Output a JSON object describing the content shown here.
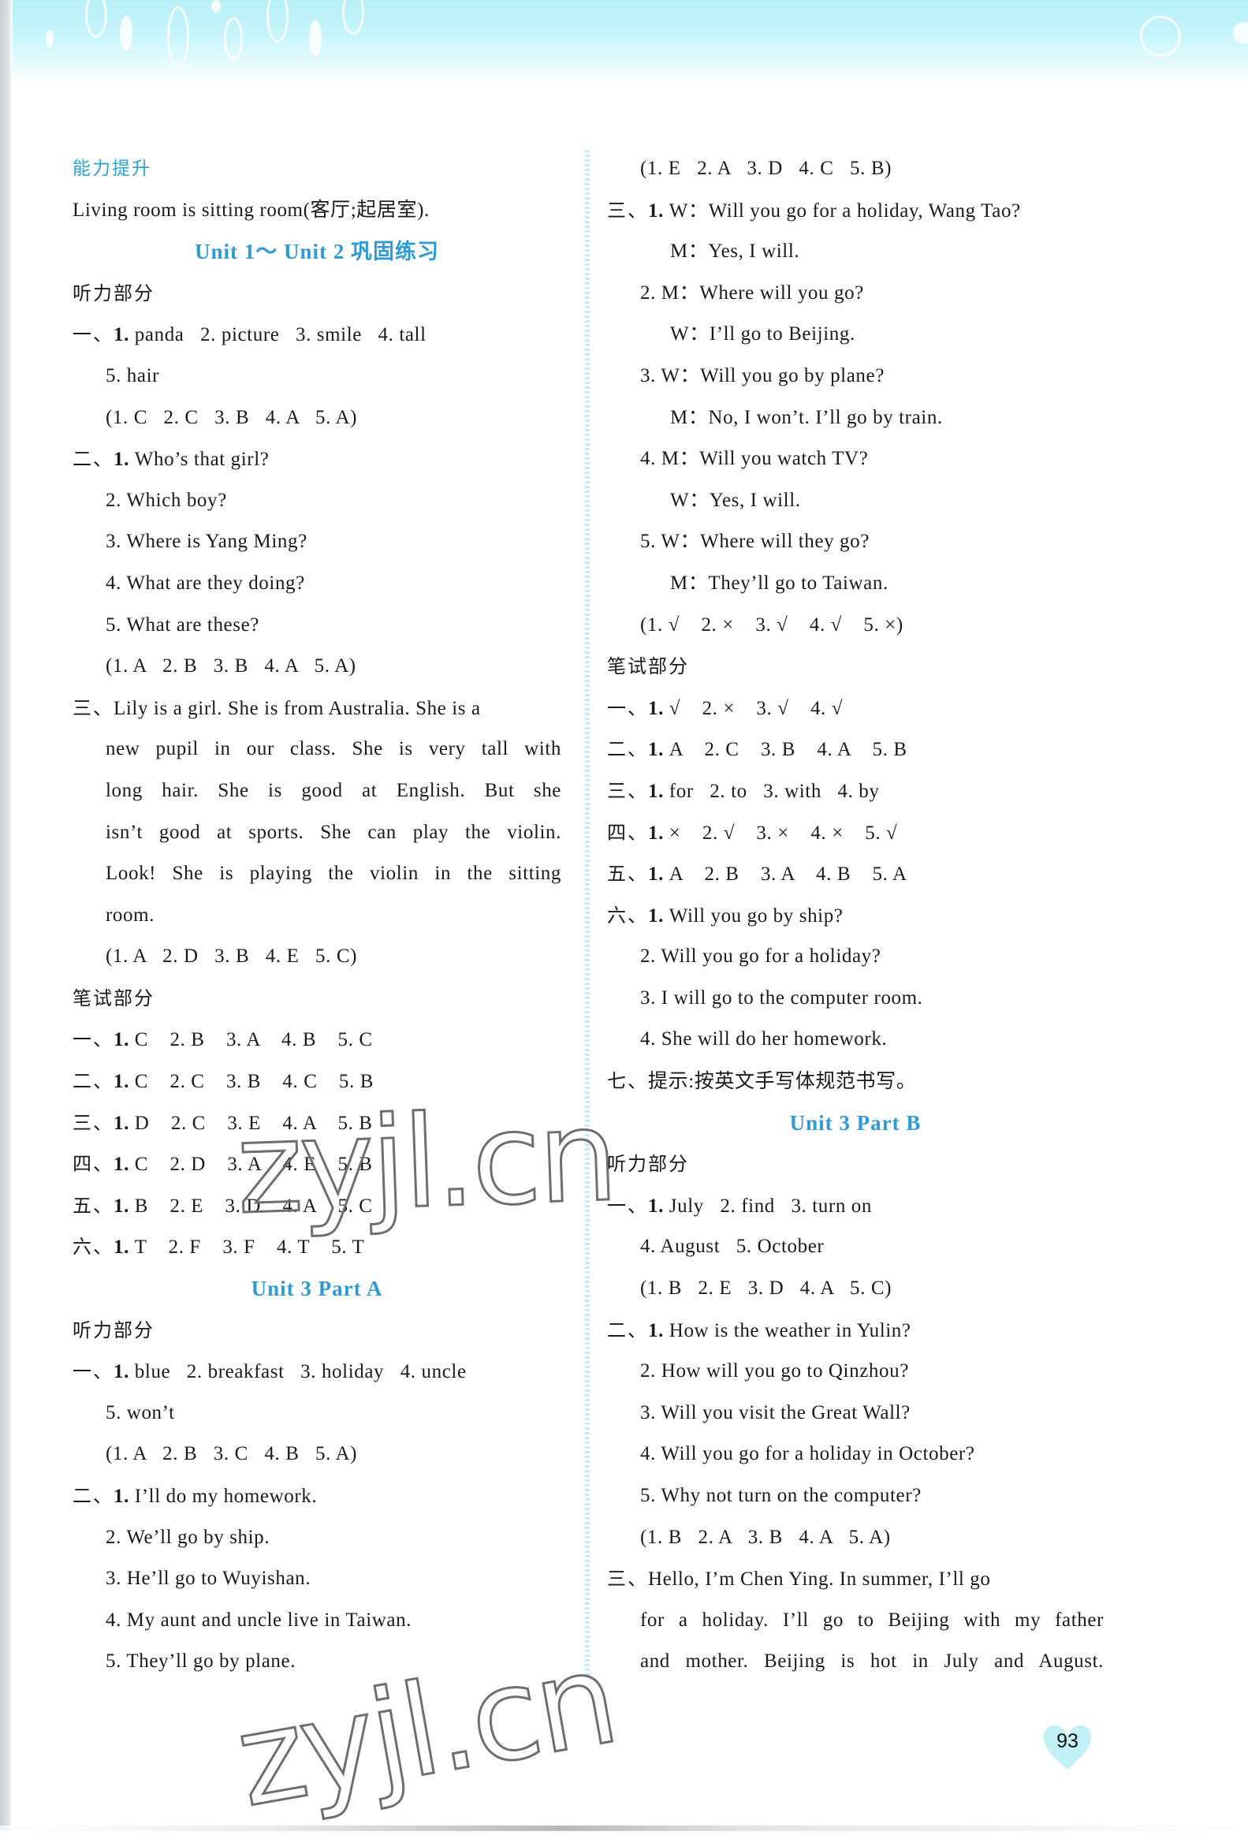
{
  "page_number": "93",
  "watermark": "zyjl.cn",
  "left_column": [
    {
      "type": "heading",
      "text": "能力提升"
    },
    {
      "type": "text",
      "indent": 0,
      "text": "Living room is sitting room(客厅;起居室)."
    },
    {
      "type": "unit-title",
      "text": "Unit 1～ Unit 2 巩固练习"
    },
    {
      "type": "section",
      "text": "听力部分"
    },
    {
      "type": "item",
      "prefix": "一、",
      "num": "1.",
      "text": " panda   2. picture   3. smile   4. tall"
    },
    {
      "type": "text",
      "indent": 1,
      "text": "5. hair"
    },
    {
      "type": "text",
      "indent": 1,
      "text": "(1. C   2. C   3. B   4. A   5. A)"
    },
    {
      "type": "item",
      "prefix": "二、",
      "num": "1.",
      "text": " Who’s that girl?"
    },
    {
      "type": "text",
      "indent": 1,
      "text": "2. Which boy?"
    },
    {
      "type": "text",
      "indent": 1,
      "text": "3. Where is Yang Ming?"
    },
    {
      "type": "text",
      "indent": 1,
      "text": "4. What are they doing?"
    },
    {
      "type": "text",
      "indent": 1,
      "text": "5. What are these?"
    },
    {
      "type": "text",
      "indent": 1,
      "text": "(1. A   2. B   3. B   4. A   5. A)"
    },
    {
      "type": "item",
      "prefix": "三、",
      "num": "",
      "text": "Lily is a girl. She is from Australia. She is a"
    },
    {
      "type": "text",
      "indent": 1,
      "justify": true,
      "text": "new pupil in our class. She is very tall with"
    },
    {
      "type": "text",
      "indent": 1,
      "justify": true,
      "text": "long hair. She is good at English. But she"
    },
    {
      "type": "text",
      "indent": 1,
      "justify": true,
      "text": "isn’t good at sports. She can play the violin."
    },
    {
      "type": "text",
      "indent": 1,
      "justify": true,
      "text": "Look! She is playing the violin in the sitting"
    },
    {
      "type": "text",
      "indent": 1,
      "text": "room."
    },
    {
      "type": "text",
      "indent": 1,
      "text": "(1. A   2. D   3. B   4. E   5. C)"
    },
    {
      "type": "section",
      "text": "笔试部分"
    },
    {
      "type": "item",
      "prefix": "一、",
      "num": "1.",
      "text": " C    2. B    3. A    4. B    5. C"
    },
    {
      "type": "item",
      "prefix": "二、",
      "num": "1.",
      "text": " C    2. C    3. B    4. C    5. B"
    },
    {
      "type": "item",
      "prefix": "三、",
      "num": "1.",
      "text": " D    2. C    3. E    4. A    5. B"
    },
    {
      "type": "item",
      "prefix": "四、",
      "num": "1.",
      "text": " C    2. D    3. A    4. E    5. B"
    },
    {
      "type": "item",
      "prefix": "五、",
      "num": "1.",
      "text": " B    2. E    3. D    4. A    5. C"
    },
    {
      "type": "item",
      "prefix": "六、",
      "num": "1.",
      "text": " T    2. F    3. F    4. T    5. T"
    },
    {
      "type": "unit-title",
      "text": "Unit 3    Part A"
    },
    {
      "type": "section",
      "text": "听力部分"
    },
    {
      "type": "item",
      "prefix": "一、",
      "num": "1.",
      "text": " blue   2. breakfast   3. holiday   4. uncle"
    },
    {
      "type": "text",
      "indent": 1,
      "text": "5. won’t"
    },
    {
      "type": "text",
      "indent": 1,
      "text": "(1. A   2. B   3. C   4. B   5. A)"
    },
    {
      "type": "item",
      "prefix": "二、",
      "num": "1.",
      "text": " I’ll do my homework."
    },
    {
      "type": "text",
      "indent": 1,
      "text": "2. We’ll go by ship."
    },
    {
      "type": "text",
      "indent": 1,
      "text": "3. He’ll go to Wuyishan."
    },
    {
      "type": "text",
      "indent": 1,
      "text": "4. My aunt and uncle live in Taiwan."
    },
    {
      "type": "text",
      "indent": 1,
      "text": "5. They’ll go by plane."
    }
  ],
  "right_column": [
    {
      "type": "text",
      "indent": 1,
      "text": "(1. E   2. A   3. D   4. C   5. B)"
    },
    {
      "type": "item",
      "prefix": "三、",
      "num": "1.",
      "text": " W：Will you go for a holiday, Wang Tao?"
    },
    {
      "type": "text",
      "indent": 2,
      "text": "M：Yes, I will."
    },
    {
      "type": "text",
      "indent": 1,
      "text": "2. M：Where will you go?"
    },
    {
      "type": "text",
      "indent": 2,
      "text": "W：I’ll go to Beijing."
    },
    {
      "type": "text",
      "indent": 1,
      "text": "3. W：Will you go by plane?"
    },
    {
      "type": "text",
      "indent": 2,
      "text": "M：No, I won’t. I’ll go by train."
    },
    {
      "type": "text",
      "indent": 1,
      "text": "4. M：Will you watch TV?"
    },
    {
      "type": "text",
      "indent": 2,
      "text": "W：Yes, I will."
    },
    {
      "type": "text",
      "indent": 1,
      "text": "5. W：Where will they go?"
    },
    {
      "type": "text",
      "indent": 2,
      "text": "M：They’ll go to Taiwan."
    },
    {
      "type": "text",
      "indent": 1,
      "text": "(1. √    2. ×    3. √    4. √    5. ×)"
    },
    {
      "type": "section",
      "text": "笔试部分"
    },
    {
      "type": "item",
      "prefix": "一、",
      "num": "1.",
      "text": " √    2. ×    3. √    4. √"
    },
    {
      "type": "item",
      "prefix": "二、",
      "num": "1.",
      "text": " A    2. C    3. B    4. A    5. B"
    },
    {
      "type": "item",
      "prefix": "三、",
      "num": "1.",
      "text": " for   2. to   3. with   4. by"
    },
    {
      "type": "item",
      "prefix": "四、",
      "num": "1.",
      "text": " ×    2. √    3. ×    4. ×    5. √"
    },
    {
      "type": "item",
      "prefix": "五、",
      "num": "1.",
      "text": " A    2. B    3. A    4. B    5. A"
    },
    {
      "type": "item",
      "prefix": "六、",
      "num": "1.",
      "text": " Will you go by ship?"
    },
    {
      "type": "text",
      "indent": 1,
      "text": "2. Will you go for a holiday?"
    },
    {
      "type": "text",
      "indent": 1,
      "text": "3. I will go to the computer room."
    },
    {
      "type": "text",
      "indent": 1,
      "text": "4. She will do her homework."
    },
    {
      "type": "item",
      "prefix": "七、",
      "num": "",
      "text": "提示:按英文手写体规范书写。"
    },
    {
      "type": "unit-title",
      "text": "Unit 3    Part B"
    },
    {
      "type": "section",
      "text": "听力部分"
    },
    {
      "type": "item",
      "prefix": "一、",
      "num": "1.",
      "text": " July   2. find   3. turn on"
    },
    {
      "type": "text",
      "indent": 1,
      "text": "4. August   5. October"
    },
    {
      "type": "text",
      "indent": 1,
      "text": "(1. B   2. E   3. D   4. A   5. C)"
    },
    {
      "type": "item",
      "prefix": "二、",
      "num": "1.",
      "text": " How is the weather in Yulin?"
    },
    {
      "type": "text",
      "indent": 1,
      "text": "2. How will you go to Qinzhou?"
    },
    {
      "type": "text",
      "indent": 1,
      "text": "3. Will you visit the Great Wall?"
    },
    {
      "type": "text",
      "indent": 1,
      "text": "4. Will you go for a holiday in October?"
    },
    {
      "type": "text",
      "indent": 1,
      "text": "5. Why not turn on the computer?"
    },
    {
      "type": "text",
      "indent": 1,
      "text": "(1. B   2. A   3. B   4. A   5. A)"
    },
    {
      "type": "item",
      "prefix": "三、",
      "num": "",
      "text": "Hello, I’m Chen Ying. In summer, I’ll go"
    },
    {
      "type": "text",
      "indent": 1,
      "justify": true,
      "text": "for a holiday. I’ll go to Beijing with my father"
    },
    {
      "type": "text",
      "indent": 1,
      "justify": true,
      "text": "and mother. Beijing is hot in July and August."
    }
  ]
}
